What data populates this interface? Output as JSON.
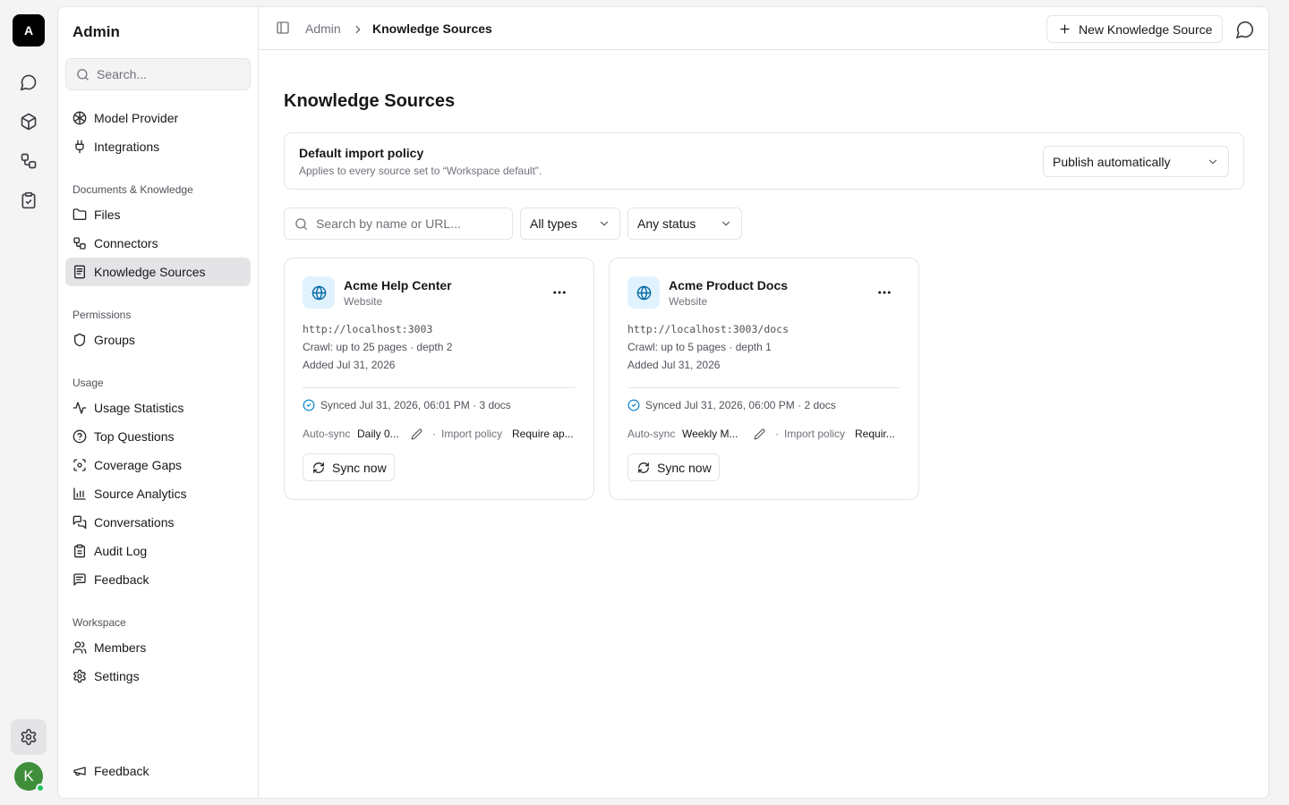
{
  "rail": {
    "logo": "A",
    "avatar": "K"
  },
  "sidebar": {
    "title": "Admin",
    "search_placeholder": "Search...",
    "top_items": [
      {
        "label": "Model Provider",
        "icon": "model-provider-icon"
      },
      {
        "label": "Integrations",
        "icon": "plug-icon"
      }
    ],
    "groups": [
      {
        "label": "Documents & Knowledge",
        "items": [
          {
            "label": "Files",
            "icon": "folder-icon"
          },
          {
            "label": "Connectors",
            "icon": "connectors-icon"
          },
          {
            "label": "Knowledge Sources",
            "icon": "book-icon",
            "active": true
          }
        ]
      },
      {
        "label": "Permissions",
        "items": [
          {
            "label": "Groups",
            "icon": "shield-icon"
          }
        ]
      },
      {
        "label": "Usage",
        "items": [
          {
            "label": "Usage Statistics",
            "icon": "activity-icon"
          },
          {
            "label": "Top Questions",
            "icon": "help-circle-icon"
          },
          {
            "label": "Coverage Gaps",
            "icon": "scan-icon"
          },
          {
            "label": "Source Analytics",
            "icon": "bar-chart-icon"
          },
          {
            "label": "Conversations",
            "icon": "messages-icon"
          },
          {
            "label": "Audit Log",
            "icon": "clipboard-icon"
          },
          {
            "label": "Feedback",
            "icon": "message-square-text-icon"
          }
        ]
      },
      {
        "label": "Workspace",
        "items": [
          {
            "label": "Members",
            "icon": "users-icon"
          },
          {
            "label": "Settings",
            "icon": "gear-icon"
          }
        ]
      }
    ],
    "footer_item": {
      "label": "Feedback",
      "icon": "megaphone-icon"
    }
  },
  "topbar": {
    "breadcrumb": [
      "Admin",
      "Knowledge Sources"
    ],
    "new_button": "New Knowledge Source"
  },
  "main": {
    "title": "Knowledge Sources",
    "policy": {
      "title": "Default import policy",
      "description": "Applies to every source set to “Workspace default”.",
      "selected": "Publish automatically"
    },
    "filters": {
      "search_placeholder": "Search by name or URL...",
      "type": "All types",
      "status": "Any status"
    },
    "sources": [
      {
        "name": "Acme Help Center",
        "type": "Website",
        "url": "http://localhost:3003",
        "crawl": "Crawl: up to 25 pages · depth 2",
        "added": "Added Jul 31, 2026",
        "synced": "Synced Jul 31, 2026, 06:01 PM · 3 docs",
        "autosync_label": "Auto-sync",
        "autosync_value": "Daily 0...",
        "policy_label": "Import policy",
        "policy_value": "Require ap...",
        "sync_button": "Sync now"
      },
      {
        "name": "Acme Product Docs",
        "type": "Website",
        "url": "http://localhost:3003/docs",
        "crawl": "Crawl: up to 5 pages · depth 1",
        "added": "Added Jul 31, 2026",
        "synced": "Synced Jul 31, 2026, 06:00 PM · 2 docs",
        "autosync_label": "Auto-sync",
        "autosync_value": "Weekly M...",
        "policy_label": "Import policy",
        "policy_value": "Requir...",
        "sync_button": "Sync now"
      }
    ]
  }
}
